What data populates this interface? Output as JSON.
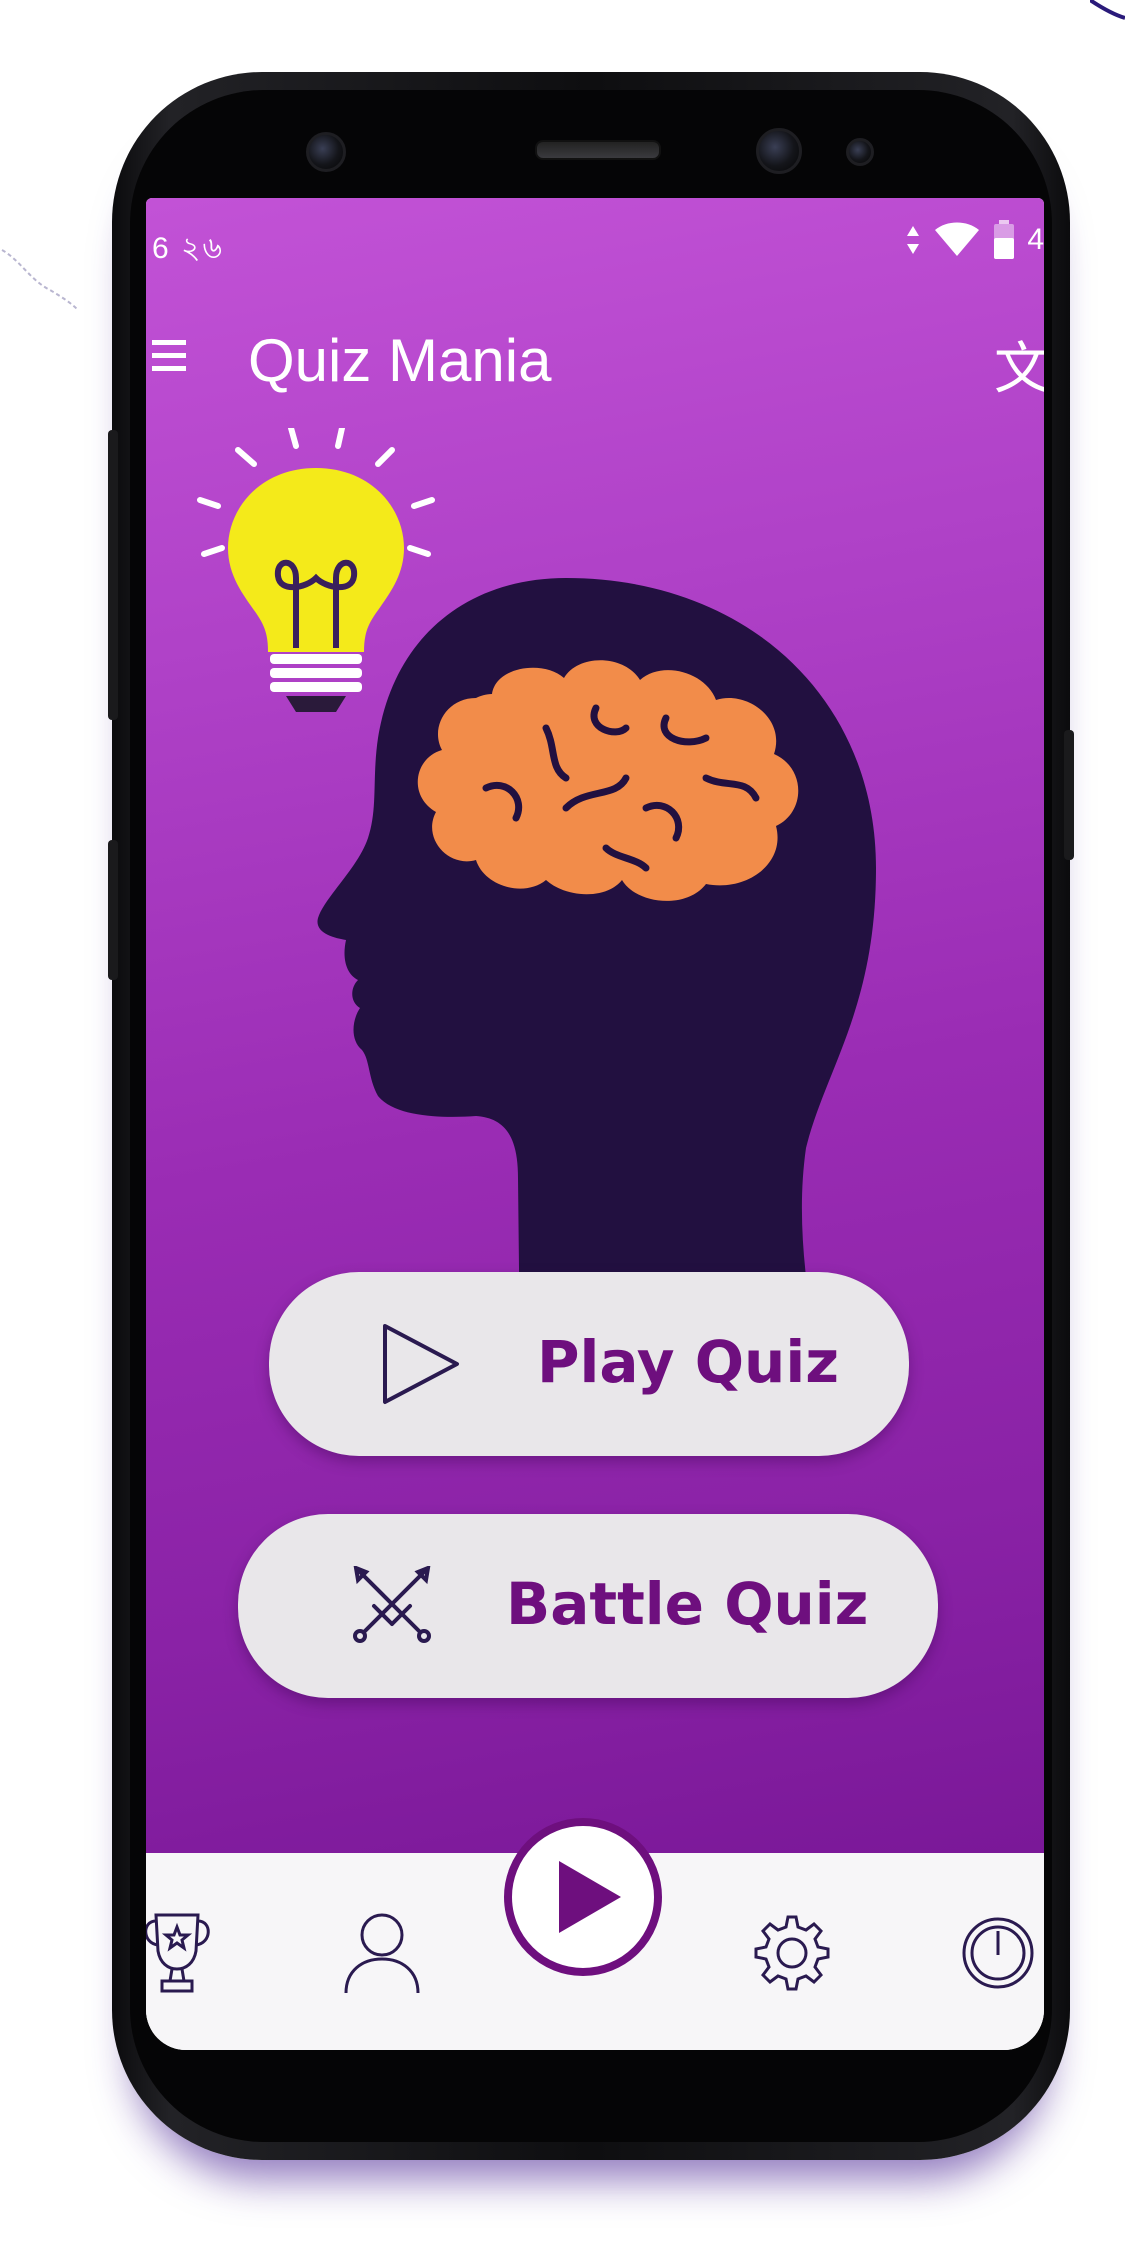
{
  "status_bar": {
    "time_fragment": "6 ২৬",
    "battery_fragment": "4"
  },
  "app_bar": {
    "title": "Quiz Mania",
    "translate_glyph": "文"
  },
  "actions": {
    "play_label": "Play Quiz",
    "battle_label": "Battle Quiz"
  },
  "bottom_nav": {
    "items": [
      {
        "icon": "trophy-icon"
      },
      {
        "icon": "profile-icon"
      },
      {
        "icon": "play-fab-icon"
      },
      {
        "icon": "settings-gear-icon"
      },
      {
        "icon": "power-icon"
      }
    ]
  },
  "colors": {
    "accent": "#6e0f7e",
    "gradient_top": "#c252d6",
    "gradient_bottom": "#7a1898",
    "button_bg": "#e9e7ea",
    "head_silhouette": "#221040",
    "brain": "#f28c4a",
    "bulb": "#f4ea1a"
  }
}
